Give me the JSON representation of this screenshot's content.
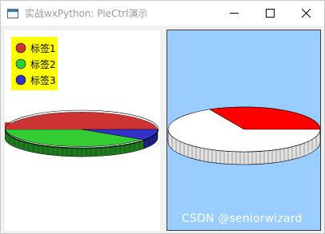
{
  "window": {
    "title": "实战wxPython: PieCtrl演示",
    "title_color": "#9a9a9a",
    "controls": [
      "minimize-icon",
      "maximize-icon",
      "close-icon"
    ]
  },
  "left_pie": {
    "background": "#ffffff",
    "legend": {
      "background": "#ffff00",
      "items": [
        {
          "label": "标签1",
          "color": "#cc3333"
        },
        {
          "label": "标签2",
          "color": "#33cc33"
        },
        {
          "label": "标签3",
          "color": "#3333cc"
        }
      ]
    }
  },
  "right_pie": {
    "background": "#99ccff",
    "slice_colors": [
      "#ff0000",
      "#ffffff"
    ]
  },
  "watermark": "CSDN @seniorwizard"
}
